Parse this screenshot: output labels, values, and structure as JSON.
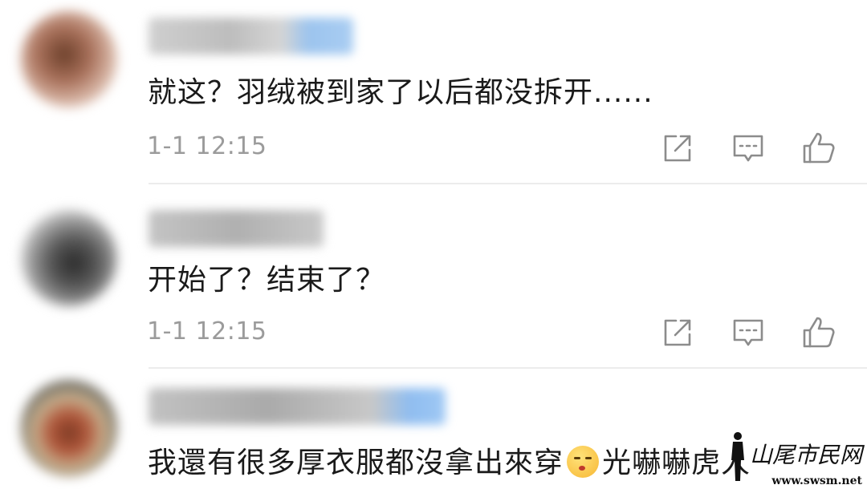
{
  "comments": [
    {
      "text": "就这？羽绒被到家了以后都没拆开......",
      "time": "1-1 12:15"
    },
    {
      "text": "开始了？结束了？",
      "time": "1-1 12:15"
    },
    {
      "text_before_emoji": "我還有很多厚衣服都沒拿出來穿",
      "emoji_icon": "shushing-face-emoji",
      "text_after_emoji": "光嚇嚇虎人"
    }
  ],
  "actions": {
    "share_icon": "share-icon",
    "comment_icon": "comment-icon",
    "like_icon": "thumbs-up-icon"
  },
  "watermark": {
    "title": "山尾市民网",
    "url": "www.swsm.net"
  },
  "colors": {
    "text": "#1a1a1a",
    "timestamp": "#9b9b9b",
    "icon": "#8c8c8c",
    "divider": "#ececec"
  }
}
